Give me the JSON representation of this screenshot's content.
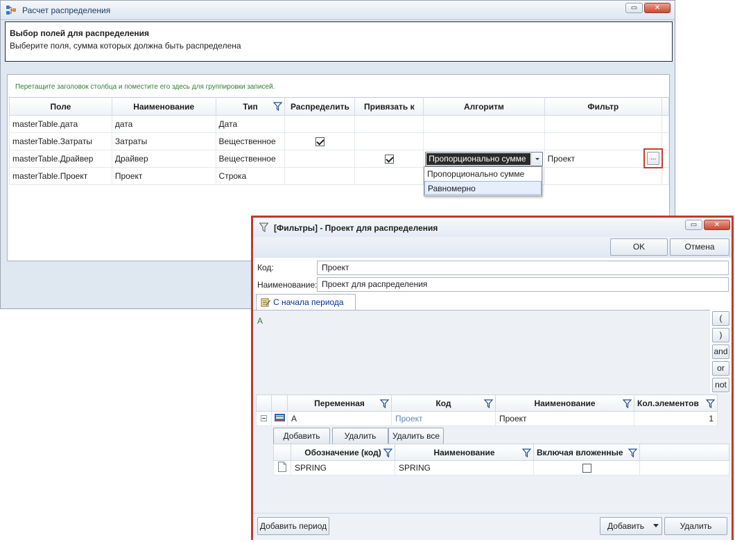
{
  "main_window": {
    "title": "Расчет распределения",
    "header": {
      "title": "Выбор полей для распределения",
      "subtitle": "Выберите поля, сумма которых должна быть распределена"
    },
    "group_hint": "Перетащите заголовок столбца и поместите его здесь для группировки записей.",
    "columns": [
      "Поле",
      "Наименование",
      "Тип",
      "Распределить",
      "Привязать к",
      "Алгоритм",
      "Фильтр"
    ],
    "rows": [
      {
        "field": "masterTable.дата",
        "name": "дата",
        "type": "Дата",
        "distribute": false,
        "bind": false,
        "algorithm": "",
        "filter": ""
      },
      {
        "field": "masterTable.Затраты",
        "name": "Затраты",
        "type": "Вещественное",
        "distribute": true,
        "bind": false,
        "algorithm": "",
        "filter": ""
      },
      {
        "field": "masterTable.Драйвер",
        "name": "Драйвер",
        "type": "Вещественное",
        "distribute": false,
        "bind": true,
        "algorithm": "Пропорционально сумме",
        "filter": "Проект"
      },
      {
        "field": "masterTable.Проект",
        "name": "Проект",
        "type": "Строка",
        "distribute": false,
        "bind": false,
        "algorithm": "",
        "filter": ""
      }
    ],
    "algorithm_options": [
      "Пропорционально сумме",
      "Равномерно"
    ],
    "ellipsis_label": "..."
  },
  "filter_window": {
    "title": "[Фильтры] - Проект для распределения",
    "ok_label": "OK",
    "cancel_label": "Отмена",
    "code_label": "Код:",
    "code_value": "Проект",
    "name_label": "Наименование:",
    "name_value": "Проект для распределения",
    "tab_label": "С начала периода",
    "expression": "A",
    "operators": [
      "(",
      ")",
      "and",
      "or",
      "not"
    ],
    "var_columns": [
      "Переменная",
      "Код",
      "Наименование",
      "Кол.элементов"
    ],
    "var_row": {
      "variable": "A",
      "code": "Проект",
      "name": "Проект",
      "count": "1"
    },
    "add_label": "Добавить",
    "delete_label": "Удалить",
    "delete_all_label": "Удалить все",
    "elem_columns": [
      "Обозначение (код)",
      "Наименование",
      "Включая вложенные"
    ],
    "elem_row": {
      "code": "SPRING",
      "name": "SPRING",
      "nested": false
    },
    "add_period_label": "Добавить период",
    "footer_add_label": "Добавить",
    "footer_delete_label": "Удалить"
  },
  "colors": {
    "accent_red": "#c0392b",
    "link_blue": "#0a2f99",
    "hint_green": "#2e7d32"
  }
}
